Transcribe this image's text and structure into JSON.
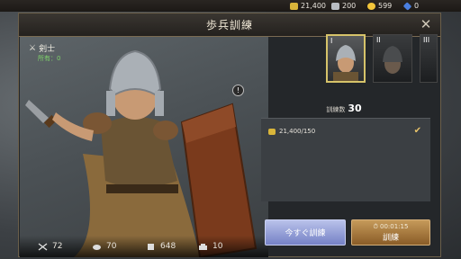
{
  "resources": [
    {
      "icon": "gold-coins-icon",
      "value": "21,400",
      "color": "#d9b53a"
    },
    {
      "icon": "iron-icon",
      "value": "200",
      "color": "#b8bcc2"
    },
    {
      "icon": "gold-medal-icon",
      "value": "599",
      "color": "#f2c53a"
    },
    {
      "icon": "blue-gem-icon",
      "value": "0",
      "color": "#4a7fe0"
    }
  ],
  "window": {
    "title": "歩兵訓練",
    "close_label": "✕"
  },
  "unit": {
    "name": "剣士",
    "owned_label": "所有：0",
    "info": "!"
  },
  "stats": [
    {
      "icon": "attack-swords-icon",
      "value": "72"
    },
    {
      "icon": "food-icon",
      "value": "70"
    },
    {
      "icon": "wood-icon",
      "value": "648"
    },
    {
      "icon": "load-icon",
      "value": "10"
    }
  ],
  "tiers": [
    {
      "label": "I",
      "selected": true
    },
    {
      "label": "II",
      "selected": false
    },
    {
      "label": "III",
      "selected": false
    }
  ],
  "training": {
    "count_label": "訓練数",
    "count": "30"
  },
  "cost": {
    "text": "21,400/150"
  },
  "buttons": {
    "instant_label": "今すぐ訓練",
    "train_label": "訓練",
    "train_time": "00:01:15"
  },
  "colors": {
    "accent_gold": "#d6c36a",
    "owned_green": "#7fd36a",
    "instant_button": "#7581c6",
    "train_button": "#8a5c27"
  }
}
